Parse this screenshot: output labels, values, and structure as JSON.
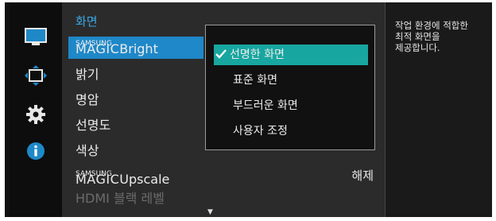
{
  "sidebar": {
    "icons": [
      "monitor-icon",
      "position-icon",
      "gear-icon",
      "info-icon"
    ]
  },
  "menu": {
    "title": "화면",
    "items": [
      {
        "prefix": "SAMSUNG",
        "main": "MAGIC",
        "suffix": "Bright",
        "selected": true
      },
      {
        "label": "밝기"
      },
      {
        "label": "명암"
      },
      {
        "label": "선명도"
      },
      {
        "label": "색상"
      },
      {
        "prefix": "SAMSUNG",
        "main": "MAGIC",
        "suffix": "Upscale",
        "value": "해제"
      },
      {
        "label": "HDMI 블랙 레벨",
        "disabled": true
      }
    ]
  },
  "popup": {
    "options": [
      "선명한 화면",
      "표준 화면",
      "부드러운 화면",
      "사용자 조정"
    ],
    "selected_index": 0
  },
  "help": {
    "text": "작업 환경에 적합한\n최적 화면을\n제공합니다."
  },
  "colors": {
    "accent_blue": "#1e88c8",
    "accent_teal": "#18a6a0",
    "title_blue": "#3aa7e6"
  }
}
